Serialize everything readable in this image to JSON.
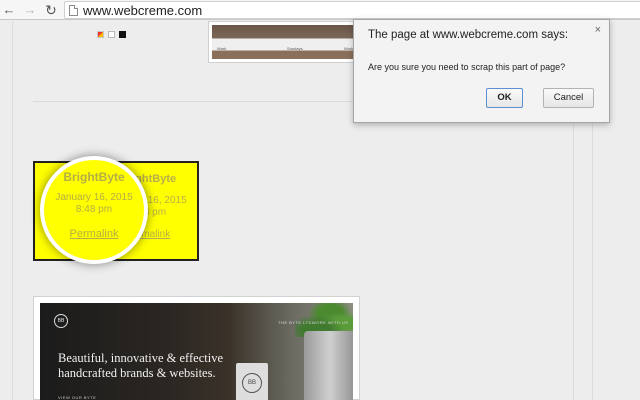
{
  "browser": {
    "url": "www.webcreme.com",
    "back_glyph": "←",
    "forward_glyph": "→",
    "reload_glyph": "↻"
  },
  "page": {
    "card": {
      "title": "BrightByte",
      "date_line1": "January 16, 2015",
      "date_line2": "8:48 pm",
      "link": "Permalink",
      "accent_color": "#ffff00"
    },
    "top_thumb": {
      "labels": [
        "Work",
        "Sundays",
        "Work"
      ]
    },
    "bottom_thumb": {
      "logo": "BB",
      "hero_line1": "Beautiful, innovative & effective",
      "hero_line2": "handcrafted brands & websites.",
      "nav_left": "THE BYTE LTD.",
      "nav_right": "WORK WITH US",
      "mug_logo": "BB",
      "bottom_label": "VIEW OUR BYTE"
    }
  },
  "dialog": {
    "title": "The page at www.webcreme.com says:",
    "close_glyph": "×",
    "message": "Are you sure you need to scrap this part of page?",
    "ok_label": "OK",
    "cancel_label": "Cancel"
  }
}
